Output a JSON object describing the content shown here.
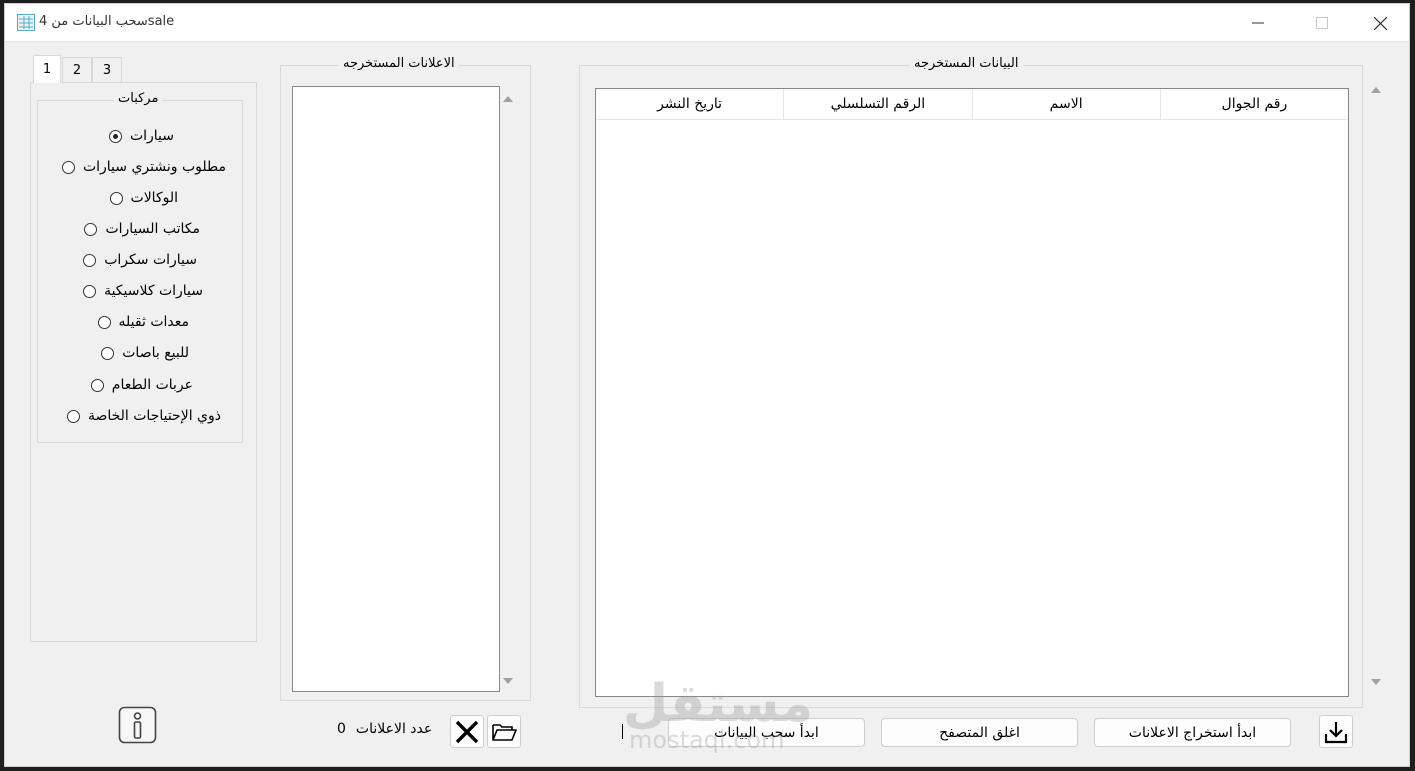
{
  "window": {
    "title": "سحب البيانات من 4sale"
  },
  "tabs": [
    {
      "label": "1",
      "active": true
    },
    {
      "label": "2",
      "active": false
    },
    {
      "label": "3",
      "active": false
    }
  ],
  "category_group": {
    "title": "مركبات",
    "options": [
      {
        "label": "سيارات",
        "checked": true
      },
      {
        "label": "مطلوب ونشتري سيارات",
        "checked": false
      },
      {
        "label": "الوكالات",
        "checked": false
      },
      {
        "label": "مكاتب السيارات",
        "checked": false
      },
      {
        "label": "سيارات سكراب",
        "checked": false
      },
      {
        "label": "سيارات كلاسيكية",
        "checked": false
      },
      {
        "label": "معدات ثقيله",
        "checked": false
      },
      {
        "label": "للبيع باصات",
        "checked": false
      },
      {
        "label": "عربات الطعام",
        "checked": false
      },
      {
        "label": "ذوي الإحتياجات الخاصة",
        "checked": false
      }
    ]
  },
  "ads_group": {
    "title": "الاعلانات المستخرجه",
    "count_label": "عدد الاعلانات",
    "count_value": "0"
  },
  "data_group": {
    "title": "البيانات المستخرجه",
    "columns": [
      "رقم الجوال",
      "الاسم",
      "الرقم التسلسلي",
      "تاريخ النشر"
    ]
  },
  "actions": {
    "start_extract_ads": "ابدأ استخراج الاعلانات",
    "close_browser": "اغلق المتصفح",
    "start_pull_data": "ابدأ سحب البيانات"
  },
  "watermark": {
    "arabic": "مستقل",
    "latin": "mostaql.com"
  },
  "colors": {
    "window_bg": "#f0f0f0",
    "titlebar_bg": "#ffffff",
    "border": "#d9d9d9"
  },
  "icons": {
    "app": "app-grid-icon",
    "info": "info-icon",
    "clear": "close-x-icon",
    "open": "folder-open-icon",
    "download": "download-icon"
  }
}
